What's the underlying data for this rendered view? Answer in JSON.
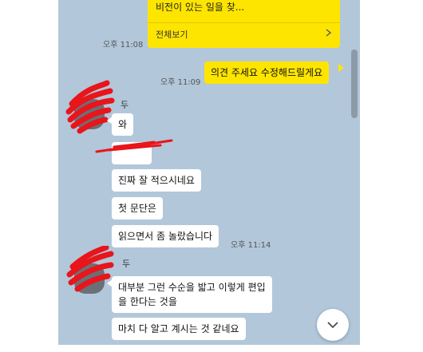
{
  "chat": {
    "card": {
      "snippet": "비전이 있는 일을 찾...",
      "view_all": "전체보기",
      "time": "오후 11:08"
    },
    "my_message": {
      "text": "의견 주세요 수정해드릴게요",
      "time": "오후 11:09"
    },
    "group1": {
      "name_fragment": "두",
      "messages": [
        "와",
        "",
        "진짜 잘 적으시네요",
        "첫 문단은",
        "읽으면서 좀 놀랐습니다"
      ],
      "time": "오후 11:14"
    },
    "group2": {
      "name_fragment": "두",
      "messages": [
        "대부분 그런 수순을 밟고 이렇게 편입",
        "을 한다는 것을",
        "마치 다 알고 계시는 것 같네요"
      ]
    }
  },
  "colors": {
    "chat_background": "#b2c7da",
    "my_bubble": "#fee500",
    "other_bubble": "#ffffff",
    "redaction": "#e8151b"
  },
  "icons": {
    "card_chevron": "chevron-right-icon",
    "scroll_down": "chevron-down-icon"
  }
}
